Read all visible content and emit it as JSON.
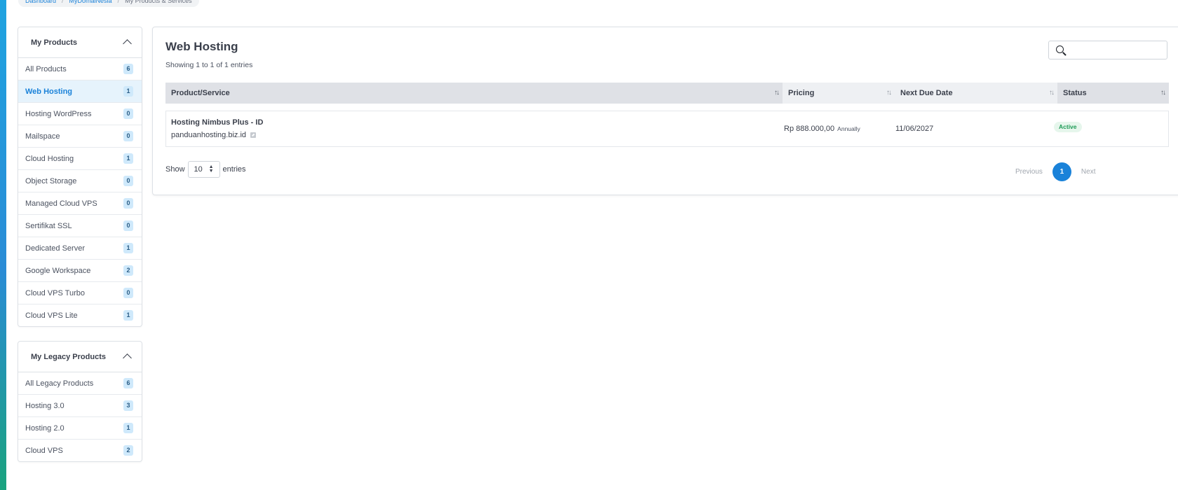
{
  "breadcrumb": {
    "items": [
      "Dashboard",
      "MyDomaiNesia",
      "My Products & Services"
    ]
  },
  "sidebar": {
    "my_products": {
      "title": "My Products",
      "items": [
        {
          "label": "All Products",
          "count": "6"
        },
        {
          "label": "Web Hosting",
          "count": "1",
          "active": true
        },
        {
          "label": "Hosting WordPress",
          "count": "0"
        },
        {
          "label": "Mailspace",
          "count": "0"
        },
        {
          "label": "Cloud Hosting",
          "count": "1"
        },
        {
          "label": "Object Storage",
          "count": "0"
        },
        {
          "label": "Managed Cloud VPS",
          "count": "0"
        },
        {
          "label": "Sertifikat SSL",
          "count": "0"
        },
        {
          "label": "Dedicated Server",
          "count": "1"
        },
        {
          "label": "Google Workspace",
          "count": "2"
        },
        {
          "label": "Cloud VPS Turbo",
          "count": "0"
        },
        {
          "label": "Cloud VPS Lite",
          "count": "1"
        }
      ]
    },
    "legacy_products": {
      "title": "My Legacy Products",
      "items": [
        {
          "label": "All Legacy Products",
          "count": "6"
        },
        {
          "label": "Hosting 3.0",
          "count": "3"
        },
        {
          "label": "Hosting 2.0",
          "count": "1"
        },
        {
          "label": "Cloud VPS",
          "count": "2"
        }
      ]
    }
  },
  "main": {
    "title": "Web Hosting",
    "subtitle": "Showing 1 to 1 of 1 entries",
    "search": {
      "placeholder": "",
      "value": ""
    },
    "table": {
      "headers": [
        "Product/Service",
        "Pricing",
        "Next Due Date",
        "Status"
      ],
      "rows": [
        {
          "product": "Hosting Nimbus Plus - ID",
          "domain": "panduanhosting.biz.id",
          "price": "Rp 888.000,00",
          "cycle": "Annually",
          "due": "11/06/2027",
          "status": "Active"
        }
      ]
    },
    "length": {
      "show": "Show",
      "value": "10",
      "entries": "entries"
    },
    "pagination": {
      "previous": "Previous",
      "current": "1",
      "next": "Next"
    }
  },
  "colors": {
    "accent": "#1a82d9",
    "active_bg": "#e6f3fc",
    "status_green": "#1e9b56"
  }
}
